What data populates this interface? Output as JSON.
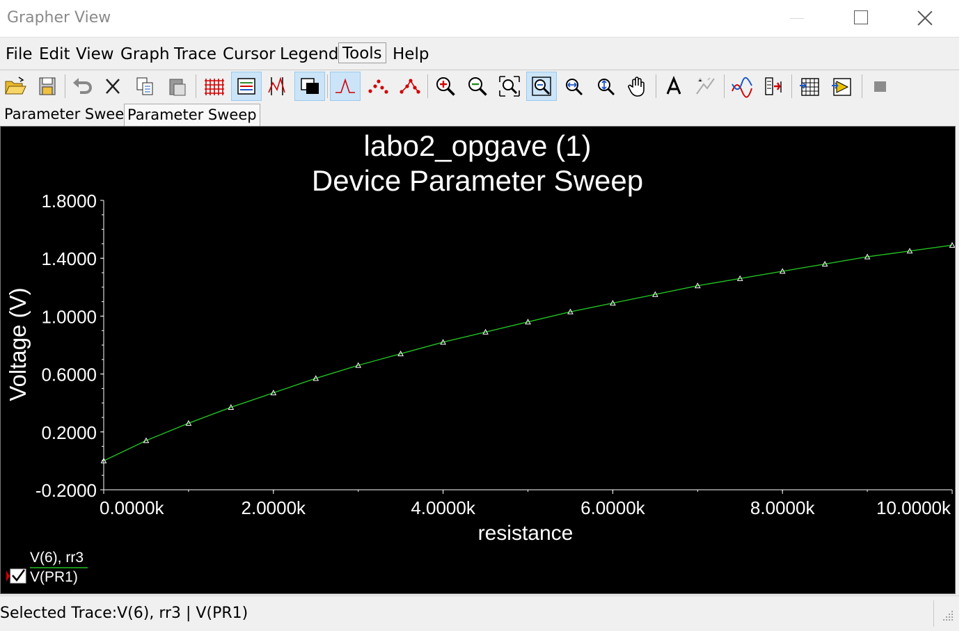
{
  "window": {
    "title": "Grapher View"
  },
  "menubar": {
    "items": [
      "File",
      "Edit",
      "View",
      "Graph",
      "Trace",
      "Cursor",
      "Legend",
      "Tools",
      "Help"
    ],
    "active": "Tools"
  },
  "toolbar": {
    "buttons": [
      {
        "icon": "open-folder-icon"
      },
      {
        "icon": "save-icon"
      },
      {
        "icon": "undo-icon"
      },
      {
        "icon": "cut-icon"
      },
      {
        "icon": "copy-icon"
      },
      {
        "icon": "paste-icon"
      },
      {
        "icon": "grid-icon"
      },
      {
        "icon": "legend-icon",
        "pressed": true
      },
      {
        "icon": "cursors-icon"
      },
      {
        "icon": "reverse-colors-icon",
        "pressed": true
      },
      {
        "icon": "show-lines-icon",
        "pressed": true
      },
      {
        "icon": "show-points-icon"
      },
      {
        "icon": "show-lines-points-icon"
      },
      {
        "icon": "zoom-in-icon"
      },
      {
        "icon": "zoom-out-icon"
      },
      {
        "icon": "zoom-area-icon"
      },
      {
        "icon": "zoom-full-icon",
        "pressed": true
      },
      {
        "icon": "zoom-x-icon"
      },
      {
        "icon": "zoom-y-icon"
      },
      {
        "icon": "pan-hand-icon"
      },
      {
        "icon": "text-label-icon"
      },
      {
        "icon": "disabled-label-icon"
      },
      {
        "icon": "overlay-traces-icon"
      },
      {
        "icon": "select-marks-icon"
      },
      {
        "icon": "export-spreadsheet-icon"
      },
      {
        "icon": "export-labview-icon"
      },
      {
        "icon": "stop-icon"
      }
    ]
  },
  "tabs": [
    "Parameter Sweep",
    "Parameter Sweep"
  ],
  "active_tab": 1,
  "plot": {
    "background": "#000000",
    "trace_color": "#22c022",
    "marker_color": "#ffffff",
    "legend_series": "V(6), rr3",
    "legend_trace": "V(PR1)",
    "legend_checked": true
  },
  "chart_data": {
    "type": "line",
    "title": "labo2_opgave (1)",
    "subtitle": "Device Parameter Sweep",
    "xlabel": "resistance",
    "ylabel": "Voltage (V)",
    "xlim": [
      0,
      10000
    ],
    "ylim": [
      -0.2,
      1.8
    ],
    "x_tick_values": [
      0,
      2000,
      4000,
      6000,
      8000,
      10000
    ],
    "x_tick_labels": [
      "0.0000k",
      "2.0000k",
      "4.0000k",
      "6.0000k",
      "8.0000k",
      "10.0000k"
    ],
    "y_tick_values": [
      1.8,
      1.4,
      1.0,
      0.6,
      0.2,
      -0.2
    ],
    "y_tick_labels": [
      "1.8000",
      "1.4000",
      "1.0000",
      "0.6000",
      "0.2000",
      "-0.2000"
    ],
    "series": [
      {
        "name": "V(PR1)",
        "x": [
          0,
          500,
          1000,
          1500,
          2000,
          2500,
          3000,
          3500,
          4000,
          4500,
          5000,
          5500,
          6000,
          6500,
          7000,
          7500,
          8000,
          8500,
          9000,
          9500,
          10000
        ],
        "y": [
          0.0,
          0.14,
          0.26,
          0.37,
          0.47,
          0.57,
          0.66,
          0.74,
          0.82,
          0.89,
          0.96,
          1.03,
          1.09,
          1.15,
          1.21,
          1.26,
          1.31,
          1.36,
          1.41,
          1.45,
          1.49
        ]
      }
    ],
    "grid": false,
    "legend_position": "bottom-left"
  },
  "status": {
    "text": "Selected Trace:V(6), rr3 | V(PR1)"
  }
}
